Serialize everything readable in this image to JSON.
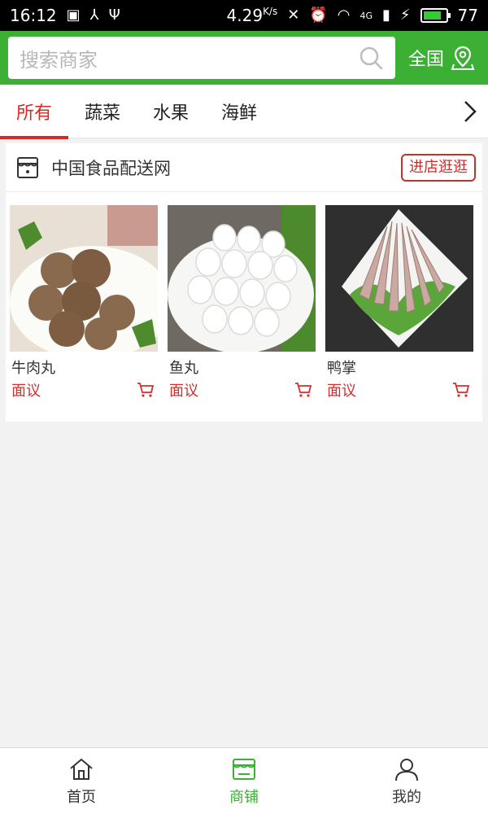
{
  "status_bar": {
    "time": "16:12",
    "speed": "4.29",
    "speed_unit": "K/s",
    "network": "4G",
    "battery": "77"
  },
  "header": {
    "search_placeholder": "搜索商家",
    "region_label": "全国"
  },
  "tabs": [
    "所有",
    "蔬菜",
    "水果",
    "海鲜"
  ],
  "active_tab_index": 0,
  "store": {
    "name": "中国食品配送网",
    "enter_label": "进店逛逛"
  },
  "products": [
    {
      "name": "牛肉丸",
      "price": "面议"
    },
    {
      "name": "鱼丸",
      "price": "面议"
    },
    {
      "name": "鸭掌",
      "price": "面议"
    }
  ],
  "bottom_nav": [
    {
      "label": "首页",
      "icon": "home-icon"
    },
    {
      "label": "商铺",
      "icon": "shop-icon"
    },
    {
      "label": "我的",
      "icon": "user-icon"
    }
  ],
  "colors": {
    "brand_green": "#3cb034",
    "accent_red": "#d52a28"
  }
}
